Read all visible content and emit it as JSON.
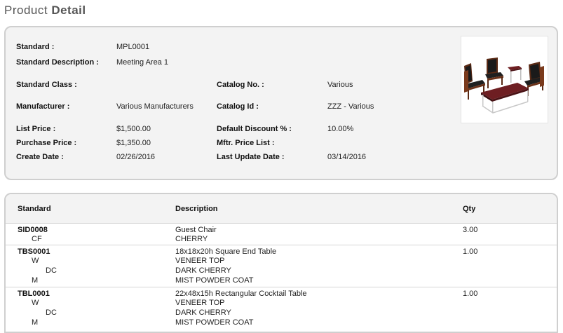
{
  "page": {
    "title_prefix": "Product",
    "title_strong": "Detail"
  },
  "detail": {
    "standard_label": "Standard :",
    "standard_value": "MPL0001",
    "description_label": "Standard Description :",
    "description_value": "Meeting Area 1",
    "class_label": "Standard Class :",
    "class_value": "",
    "catalog_no_label": "Catalog No. :",
    "catalog_no_value": "Various",
    "manufacturer_label": "Manufacturer :",
    "manufacturer_value": "Various Manufacturers",
    "catalog_id_label": "Catalog Id :",
    "catalog_id_value": "ZZZ - Various",
    "list_price_label": "List Price :",
    "list_price_value": "$1,500.00",
    "default_discount_label": "Default Discount % :",
    "default_discount_value": "10.00%",
    "purchase_price_label": "Purchase Price :",
    "purchase_price_value": "$1,350.00",
    "mftr_price_list_label": "Mftr. Price List :",
    "mftr_price_list_value": "",
    "create_date_label": "Create Date :",
    "create_date_value": "02/26/2016",
    "last_update_label": "Last Update Date :",
    "last_update_value": "03/14/2016"
  },
  "components": {
    "headers": {
      "standard": "Standard",
      "description": "Description",
      "qty": "Qty"
    },
    "rows": [
      {
        "code": "SID0008",
        "description": "Guest Chair",
        "qty": "3.00",
        "options": [
          {
            "code": "CF",
            "desc": "CHERRY"
          }
        ]
      },
      {
        "code": "TBS0001",
        "description": "18x18x20h Square End Table",
        "qty": "1.00",
        "options": [
          {
            "code": "W",
            "desc": "VENEER TOP"
          },
          {
            "code": "DC",
            "desc": "DARK CHERRY"
          },
          {
            "code": "M",
            "desc": "MIST POWDER COAT"
          }
        ]
      },
      {
        "code": "TBL0001",
        "description": "22x48x15h Rectangular Cocktail Table",
        "qty": "1.00",
        "options": [
          {
            "code": "W",
            "desc": "VENEER TOP"
          },
          {
            "code": "DC",
            "desc": "DARK CHERRY"
          },
          {
            "code": "M",
            "desc": "MIST POWDER COAT"
          }
        ]
      }
    ]
  }
}
